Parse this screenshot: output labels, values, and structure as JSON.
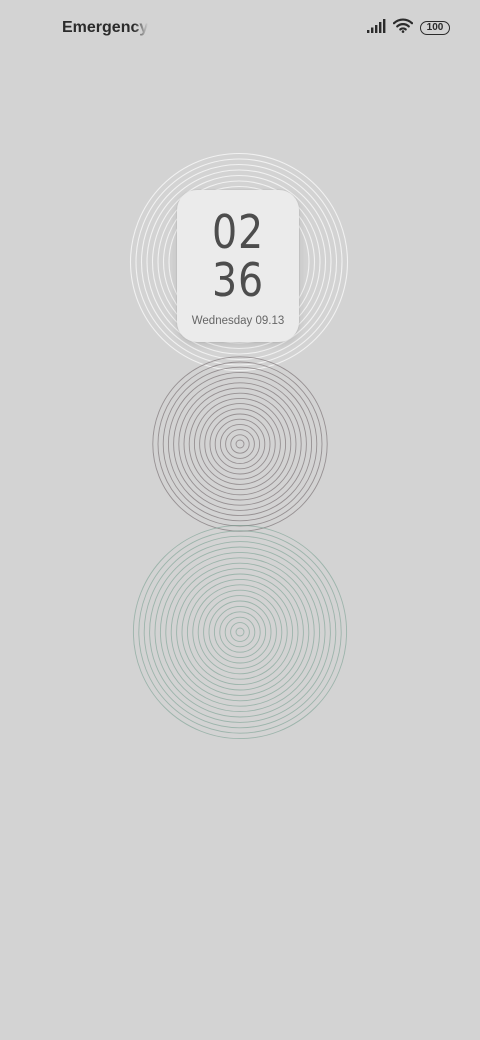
{
  "status_bar": {
    "carrier_text": "Emergency calls only",
    "signal_icon": "signal-bars-icon",
    "wifi_icon": "wifi-icon",
    "battery_level": "100"
  },
  "clock_widget": {
    "hours": "02",
    "minutes": "36",
    "date": "Wednesday 09.13"
  },
  "wallpaper": {
    "circle_colors": [
      "#f2f2f2",
      "#6e6468",
      "#6f9a8a"
    ]
  }
}
